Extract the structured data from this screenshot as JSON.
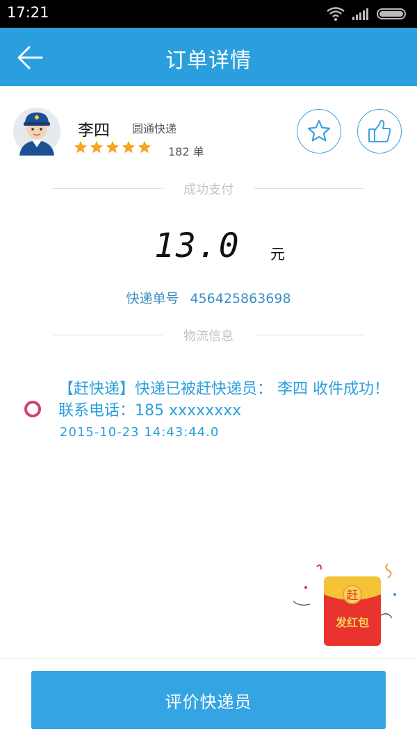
{
  "status_bar": {
    "time": "17:21",
    "icons": [
      "wifi-icon",
      "signal-icon",
      "battery-icon"
    ]
  },
  "header": {
    "title": "订单详情",
    "back_icon": "arrow-left-icon",
    "background": "#2b9fdd"
  },
  "courier": {
    "name": "李四",
    "company": "圆通快递",
    "rating": 5,
    "rating_max": 5,
    "orders": "182 单",
    "favorite_icon": "star-outline-icon",
    "like_icon": "thumbs-up-icon"
  },
  "payment": {
    "section_label": "成功支付",
    "amount": "13.0",
    "currency": "元",
    "tracking_label": "快递单号",
    "tracking_number": "456425863698"
  },
  "logistics": {
    "section_label": "物流信息",
    "entries": [
      {
        "text": "【赶快递】快递已被赶快递员：  李四 收件成功！联系电话：185 xxxxxxxx",
        "time": "2015-10-23  14:43:44.0"
      }
    ]
  },
  "red_envelope": {
    "badge": "赶",
    "label": "发红包",
    "color": "#e8332f"
  },
  "footer": {
    "rate_button": "评价快递员",
    "accent": "#35a4e2"
  }
}
